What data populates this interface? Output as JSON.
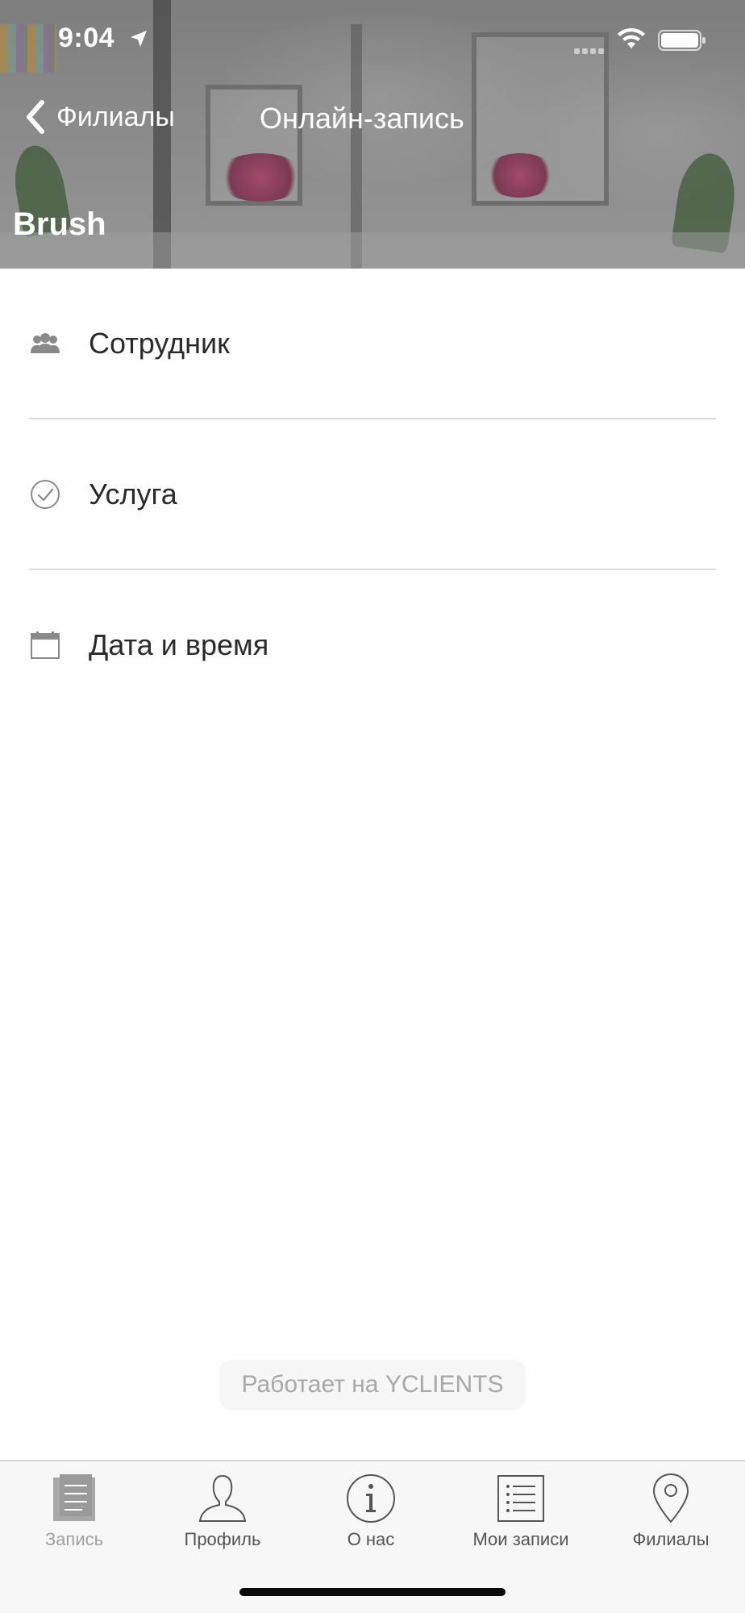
{
  "status_bar": {
    "time": "9:04"
  },
  "nav": {
    "back_label": "Филиалы",
    "title": "Онлайн-запись",
    "branch_name": "Brush"
  },
  "menu": {
    "items": [
      {
        "label": "Сотрудник",
        "icon": "staff-icon"
      },
      {
        "label": "Услуга",
        "icon": "check-circle-icon"
      },
      {
        "label": "Дата и время",
        "icon": "calendar-icon"
      }
    ]
  },
  "footer": {
    "powered_by": "Работает на YCLIENTS"
  },
  "tabbar": {
    "items": [
      {
        "label": "Запись",
        "icon": "notepad-icon",
        "active": true
      },
      {
        "label": "Профиль",
        "icon": "profile-icon",
        "active": false
      },
      {
        "label": "О нас",
        "icon": "info-icon",
        "active": false
      },
      {
        "label": "Мои записи",
        "icon": "list-icon",
        "active": false
      },
      {
        "label": "Филиалы",
        "icon": "location-pin-icon",
        "active": false
      }
    ]
  },
  "colors": {
    "header_overlay": "#8a8a8a",
    "tab_active": "#a0a0a0",
    "tab_inactive": "#555555",
    "divider": "#dcdcdc"
  }
}
